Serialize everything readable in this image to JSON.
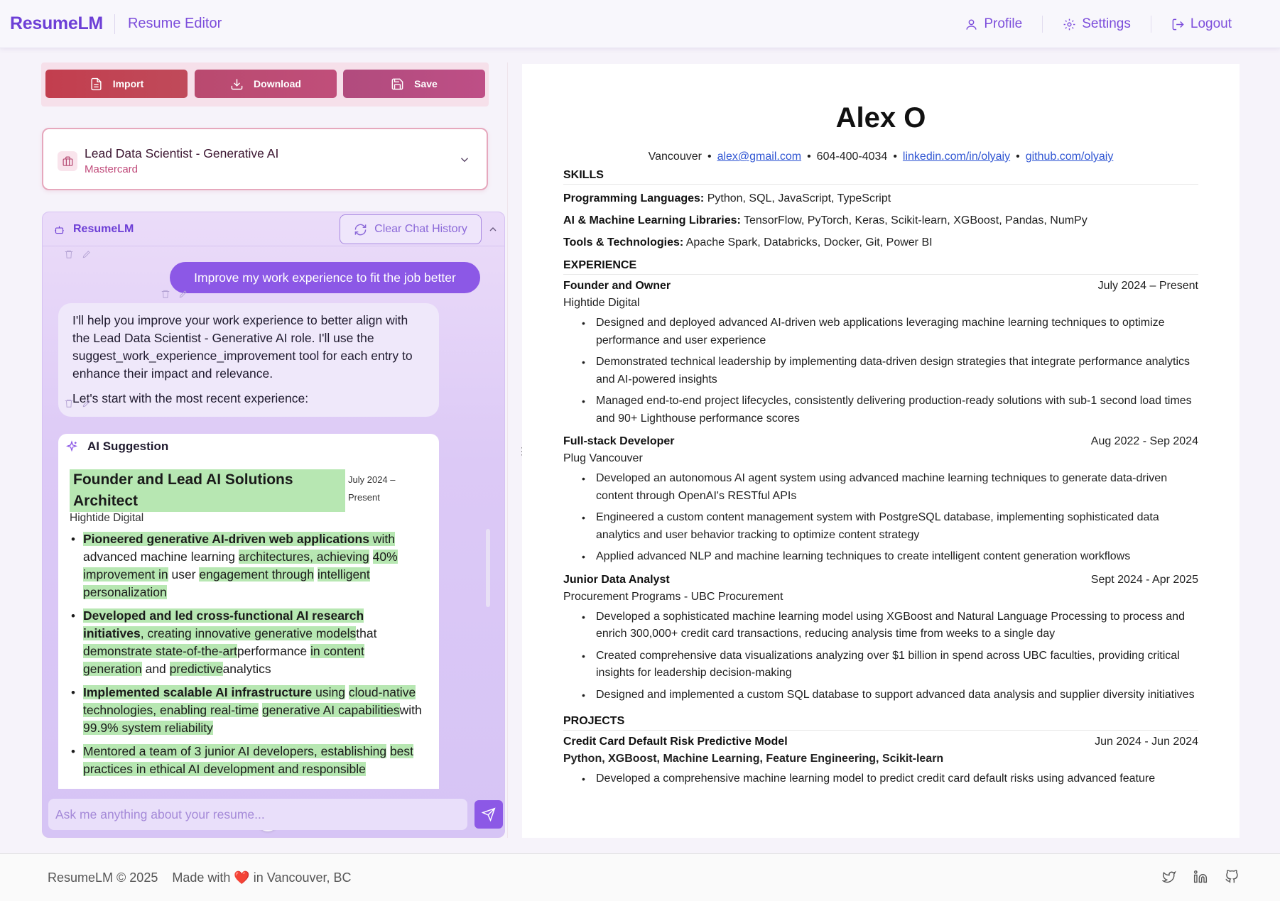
{
  "header": {
    "brand": "ResumeLM",
    "page": "Resume Editor",
    "nav": {
      "profile": "Profile",
      "settings": "Settings",
      "logout": "Logout"
    }
  },
  "toolbar": {
    "import": "Import",
    "download": "Download",
    "save": "Save"
  },
  "job": {
    "title": "Lead Data Scientist - Generative AI",
    "company": "Mastercard"
  },
  "chat": {
    "title": "ResumeLM",
    "clear": "Clear Chat History",
    "user_message": "Improve my work experience to fit the job better",
    "bot_message_1": "I'll help you improve your work experience to better align with the Lead Data Scientist - Generative AI role. I'll use the suggest_work_experience_improvement tool for each entry to enhance their impact and relevance.",
    "bot_message_2": "Let's start with the most recent experience:",
    "input_placeholder": "Ask me anything about your resume...",
    "suggestion": {
      "heading": "AI Suggestion",
      "role": "Founder and Lead AI Solutions Architect",
      "date": "July 2024 – Present",
      "company": "Hightide Digital",
      "b1": [
        "Pioneered generative AI-driven web applications",
        " with",
        " advanced machine learning ",
        "architectures, achieving",
        "40% improvement",
        " in",
        " user ",
        "engagement through",
        "intelligent personalization"
      ],
      "b2": [
        "Developed and led cross-functional AI research initiatives",
        ", creating innovative generative models",
        "that",
        "demonstrate state-of-the-art",
        "performance ",
        "in content",
        "generation",
        " and ",
        "predictive",
        "analytics"
      ],
      "b3": [
        "Implemented scalable AI infrastructure",
        " using",
        "cloud-native technologies, enabling real-time",
        "generative AI capabilities",
        "with",
        " 99.9% system reliability"
      ],
      "b4": [
        "Mentored a team of 3 junior AI developers, establishing",
        "best practices in ethical AI development and responsible"
      ]
    }
  },
  "resume": {
    "name": "Alex O",
    "location": "Vancouver",
    "email": "alex@gmail.com",
    "phone": "604-400-4034",
    "linkedin": "linkedin.com/in/olyaiy",
    "github": "github.com/olyaiy",
    "skills_title": "SKILLS",
    "skills": [
      {
        "label": "Programming Languages:",
        "value": "Python, SQL, JavaScript, TypeScript"
      },
      {
        "label": "AI & Machine Learning Libraries:",
        "value": "TensorFlow, PyTorch, Keras, Scikit-learn, XGBoost, Pandas, NumPy"
      },
      {
        "label": "Tools & Technologies:",
        "value": "Apache Spark, Databricks, Docker, Git, Power BI"
      }
    ],
    "experience_title": "EXPERIENCE",
    "experience": [
      {
        "role": "Founder and Owner",
        "date": "July 2024 – Present",
        "company": "Hightide Digital",
        "bullets": [
          "Designed and deployed advanced AI-driven web applications leveraging machine learning techniques to optimize performance and user experience",
          "Demonstrated technical leadership by implementing data-driven design strategies that integrate performance analytics and AI-powered insights",
          "Managed end-to-end project lifecycles, consistently delivering production-ready solutions with sub-1 second load times and 90+ Lighthouse performance scores"
        ]
      },
      {
        "role": "Full-stack Developer",
        "date": "Aug 2022 - Sep 2024",
        "company": "Plug Vancouver",
        "bullets": [
          "Developed an autonomous AI agent system using advanced machine learning techniques to generate data-driven content through OpenAI's RESTful APIs",
          "Engineered a custom content management system with PostgreSQL database, implementing sophisticated data analytics and user behavior tracking to optimize content strategy",
          "Applied advanced NLP and machine learning techniques to create intelligent content generation workflows"
        ]
      },
      {
        "role": "Junior Data Analyst",
        "date": "Sept 2024 - Apr 2025",
        "company": "Procurement Programs - UBC Procurement",
        "bullets": [
          "Developed a sophisticated machine learning model using XGBoost and Natural Language Processing to process and enrich 300,000+ credit card transactions, reducing analysis time from weeks to a single day",
          "Created comprehensive data visualizations analyzing over $1 billion in spend across UBC faculties, providing critical insights for leadership decision-making",
          "Designed and implemented a custom SQL database to support advanced data analysis and supplier diversity initiatives"
        ]
      }
    ],
    "projects_title": "PROJECTS",
    "project": {
      "name": "Credit Card Default Risk Predictive Model",
      "date": "Jun 2024 - Jun 2024",
      "tech": "Python, XGBoost, Machine Learning, Feature Engineering, Scikit-learn",
      "bullet": "Developed a comprehensive machine learning model to predict credit card default risks using advanced feature"
    }
  },
  "footer": {
    "copyright": "ResumeLM © 2025",
    "made_with": "Made with ❤️ in Vancouver, BC"
  }
}
